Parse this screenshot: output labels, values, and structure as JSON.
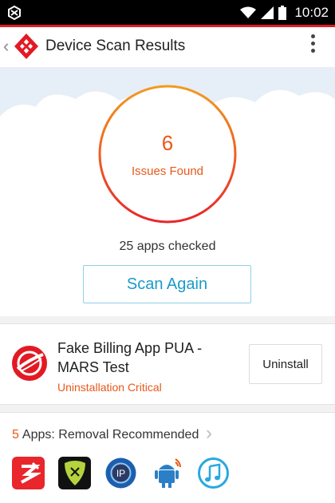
{
  "status_bar": {
    "time": "10:02",
    "icons": [
      "app-notification-icon",
      "wifi-icon",
      "signal-icon",
      "battery-icon"
    ]
  },
  "app_bar": {
    "title": "Device Scan Results",
    "icons": [
      "back-chevron-icon",
      "app-logo-icon",
      "overflow-menu-icon"
    ]
  },
  "scan_summary": {
    "issue_count": "6",
    "issue_label": "Issues Found",
    "apps_checked": "25 apps checked",
    "scan_again_label": "Scan Again"
  },
  "threat": {
    "name": "Fake Billing App PUA - MARS Test",
    "status": "Uninstallation Critical",
    "action_label": "Uninstall",
    "icon": "threat-app-icon"
  },
  "removal": {
    "count": "5",
    "label": "Apps: Removal Recommended",
    "apps": [
      {
        "icon": "red-app-icon"
      },
      {
        "icon": "green-guitar-pick-icon"
      },
      {
        "icon": "ip-globe-icon"
      },
      {
        "icon": "android-robot-icon"
      },
      {
        "icon": "music-note-icon"
      }
    ]
  },
  "colors": {
    "accent": "#e8581a",
    "brand_red": "#e21a23",
    "link_blue": "#1a9bc9"
  }
}
